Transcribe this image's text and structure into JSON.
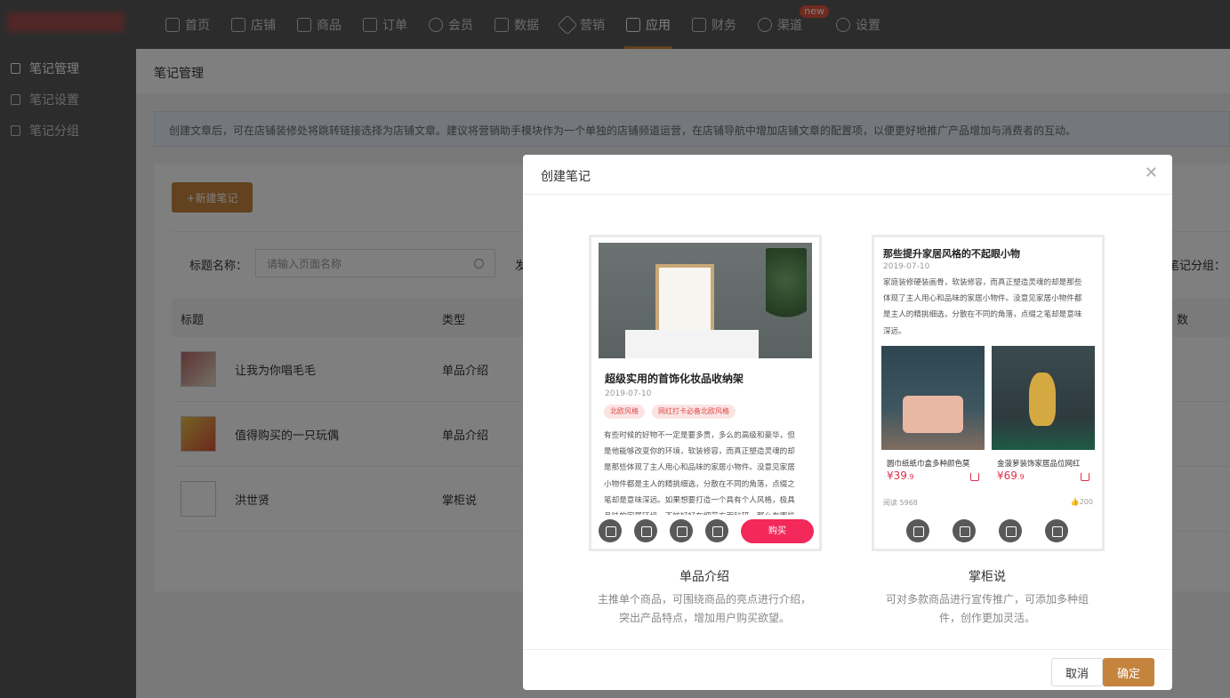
{
  "nav": {
    "items": [
      {
        "label": "首页",
        "icon": "home-icon"
      },
      {
        "label": "店铺",
        "icon": "shop-icon"
      },
      {
        "label": "商品",
        "icon": "goods-icon"
      },
      {
        "label": "订单",
        "icon": "order-icon"
      },
      {
        "label": "会员",
        "icon": "member-icon"
      },
      {
        "label": "数据",
        "icon": "data-icon"
      },
      {
        "label": "营销",
        "icon": "tag-icon"
      },
      {
        "label": "应用",
        "icon": "app-icon"
      },
      {
        "label": "财务",
        "icon": "finance-icon"
      },
      {
        "label": "渠道",
        "icon": "channel-icon"
      },
      {
        "label": "设置",
        "icon": "settings-icon"
      }
    ],
    "channel_badge": "new"
  },
  "sidebar": {
    "items": [
      {
        "label": "笔记管理"
      },
      {
        "label": "笔记设置"
      },
      {
        "label": "笔记分组"
      }
    ]
  },
  "page": {
    "breadcrumb": "笔记管理",
    "notice": "创建文章后，可在店铺装修处将跳转链接选择为店铺文章。建议将营销助手模块作为一个单独的店铺频道运营，在店铺导航中增加店铺文章的配置项，以便更好地推广产品增加与消费者的互动。",
    "new_button": "+新建笔记",
    "filter_label": "标题名称：",
    "filter_placeholder": "请输入页面名称",
    "filter_extra": "发",
    "filter_group": "笔记分组：",
    "columns": {
      "title": "标题",
      "type": "类型",
      "extra": "数"
    },
    "rows": [
      {
        "name": "让我为你唱毛毛",
        "type": "单品介绍"
      },
      {
        "name": "值得购买的一只玩偶",
        "type": "单品介绍"
      },
      {
        "name": "洪世贤",
        "type": "掌柜说"
      }
    ]
  },
  "modal": {
    "title": "创建笔记",
    "cancel": "取消",
    "ok": "确定",
    "options": [
      {
        "name": "单品介绍",
        "desc1": "主推单个商品，可围绕商品的亮点进行介绍，",
        "desc2": "突出产品特点，增加用户购买欲望。",
        "preview": {
          "title": "超级实用的首饰化妆品收纳架",
          "date": "2019-07-10",
          "tags": [
            "北欧风格",
            "网红打卡必备北欧风格"
          ],
          "body": [
            "有些时候的好物不一定是要多贵，多么的高级和豪华，但",
            "是他能够改变你的环境，软装修容，而真正塑造灵魂的却",
            "是那些体现了主人用心和品味的家居小物件。没意见家居",
            "小物件都是主人的精挑细选，分散在不同的角落，点缀之",
            "笔却是意味深远。如果想要打造一个具有个人风格，极具",
            "品味的家居环境，不妨好好在细节方面钻研。那么有哪些"
          ],
          "buy": "购买"
        }
      },
      {
        "name": "掌柜说",
        "desc1": "可对多款商品进行宣传推广，可添加多种组",
        "desc2": "件，创作更加灵活。",
        "preview": {
          "title": "那些提升家居风格的不起眼小物",
          "date": "2019-07-10",
          "body": [
            "家庭装修硬装画骨，软装修容，而真正塑造灵魂的却是那些",
            "体现了主人用心和品味的家居小物件。没意见家居小物件都",
            "是主人的精挑细选，分散在不同的角落，点缀之笔却是意味",
            "深远。"
          ],
          "products": [
            {
              "name": "圆巾纸纸巾盒多种颜色莫",
              "price_main": "¥39",
              "price_dec": ".9"
            },
            {
              "name": "金菠萝装饰家居品位网红",
              "price_main": "¥69",
              "price_dec": ".9"
            }
          ],
          "reads": "阅读 5968",
          "likes": "200"
        }
      }
    ]
  },
  "colors": {
    "accent": "#c5843e",
    "buy": "#f2295a"
  }
}
